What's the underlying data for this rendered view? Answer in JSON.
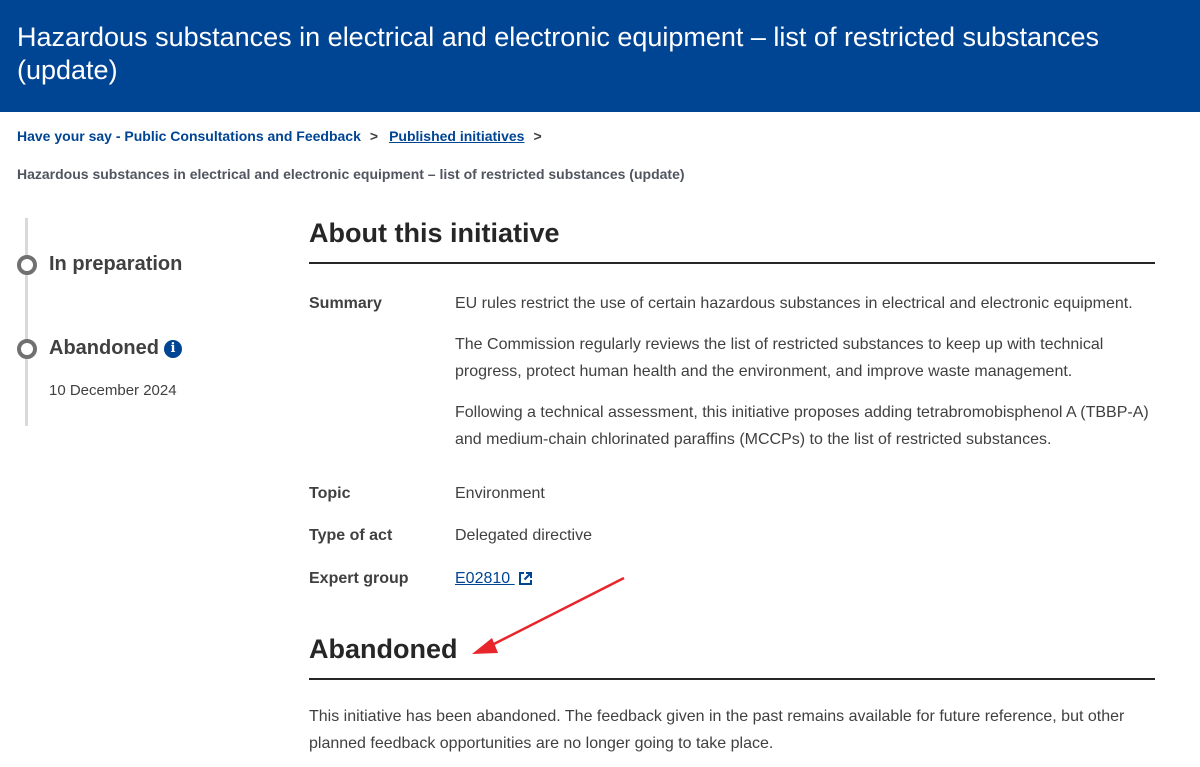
{
  "header": {
    "title": "Hazardous substances in electrical and electronic equipment – list of restricted substances (update)"
  },
  "breadcrumb": {
    "items": [
      {
        "label": "Have your say - Public Consultations and Feedback"
      },
      {
        "label": "Published initiatives"
      }
    ],
    "separator": ">",
    "current": "Hazardous substances in electrical and electronic equipment – list of restricted substances (update)"
  },
  "timeline": {
    "steps": [
      {
        "label": "In preparation"
      },
      {
        "label": "Abandoned",
        "date": "10 December 2024"
      }
    ],
    "info_glyph": "i"
  },
  "about": {
    "title": "About this initiative",
    "summary_label": "Summary",
    "summary_paragraphs": [
      "EU rules restrict the use of certain hazardous substances in electrical and electronic equipment.",
      "The Commission regularly reviews the list of restricted substances to keep up with technical progress, protect human health and the environment, and improve waste management.",
      "Following a technical assessment, this initiative proposes adding tetrabromobisphenol A (TBBP-A) and medium-chain chlorinated paraffins (MCCPs) to the list of restricted substances."
    ],
    "topic_label": "Topic",
    "topic_value": "Environment",
    "type_label": "Type of act",
    "type_value": "Delegated directive",
    "expert_label": "Expert group",
    "expert_value": "E02810"
  },
  "abandoned": {
    "title": "Abandoned",
    "text": "This initiative has been abandoned. The feedback given in the past remains available for future reference, but other planned feedback opportunities are no longer going to take place."
  },
  "colors": {
    "brand": "#004494",
    "annotation_arrow": "#e8252a"
  },
  "icons": {
    "info": "info-icon",
    "external_link": "external-link-icon",
    "chevron": "chevron-right-icon"
  }
}
